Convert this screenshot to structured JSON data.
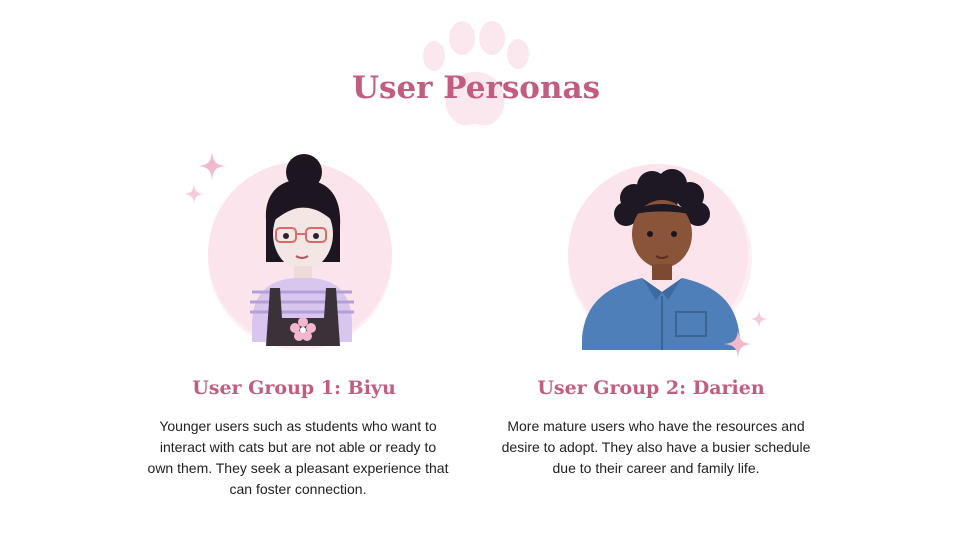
{
  "slide": {
    "title": "User Personas",
    "accent_color": "#c35d7f",
    "decoration_color": "#f7dce6"
  },
  "groups": [
    {
      "title": "User Group 1: Biyu",
      "description": "Younger users such as students who want to interact with cats but are not able or ready to own them. They seek a pleasant experience that can foster connection.",
      "avatar_icon": "biyu-avatar-icon"
    },
    {
      "title": "User Group 2: Darien",
      "description": "More mature users who have the resources and desire to adopt. They also have a busier schedule due to their career and family life.",
      "avatar_icon": "darien-avatar-icon"
    }
  ]
}
